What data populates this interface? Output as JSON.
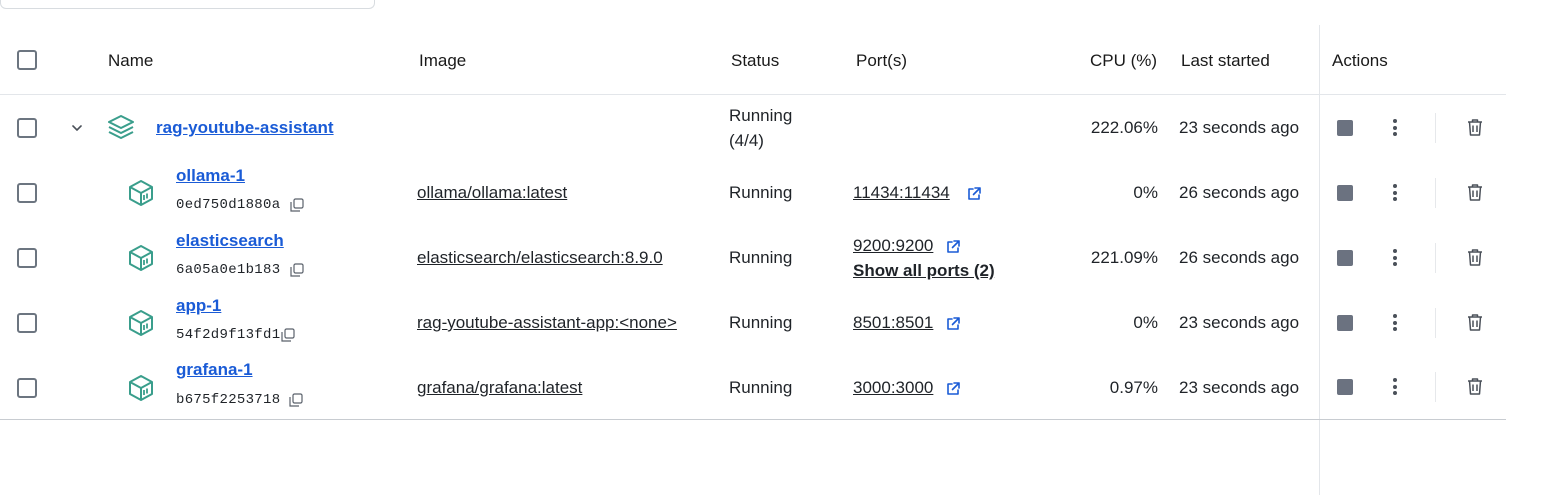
{
  "table": {
    "headers": {
      "name": "Name",
      "image": "Image",
      "status": "Status",
      "ports": "Port(s)",
      "cpu": "CPU (%)",
      "last_started": "Last started",
      "actions": "Actions"
    },
    "group": {
      "name": "rag-youtube-assistant",
      "status_line1": "Running",
      "status_line2": "(4/4)",
      "cpu": "222.06%",
      "last_started": "23 seconds ago"
    },
    "rows": [
      {
        "name": "ollama-1",
        "id": "0ed750d1880a",
        "image": "ollama/ollama:latest",
        "status": "Running",
        "port": "11434:11434",
        "cpu": "0%",
        "last_started": "26 seconds ago"
      },
      {
        "name": "elasticsearch",
        "id": "6a05a0e1b183",
        "image": "elasticsearch/elasticsearch:8.9.0",
        "status": "Running",
        "port": "9200:9200",
        "show_ports": "Show all ports (2)",
        "cpu": "221.09%",
        "last_started": "26 seconds ago"
      },
      {
        "name": "app-1",
        "id": "54f2d9f13fd1",
        "image": "rag-youtube-assistant-app:<none>",
        "status": "Running",
        "port": "8501:8501",
        "cpu": "0%",
        "last_started": "23 seconds ago"
      },
      {
        "name": "grafana-1",
        "id": "b675f2253718",
        "image": "grafana/grafana:latest",
        "status": "Running",
        "port": "3000:3000",
        "cpu": "0.97%",
        "last_started": "23 seconds ago"
      }
    ]
  },
  "colors": {
    "link": "#1a5bd6",
    "icon_teal": "#3a9e8c",
    "stop_gray": "#6b7280"
  }
}
